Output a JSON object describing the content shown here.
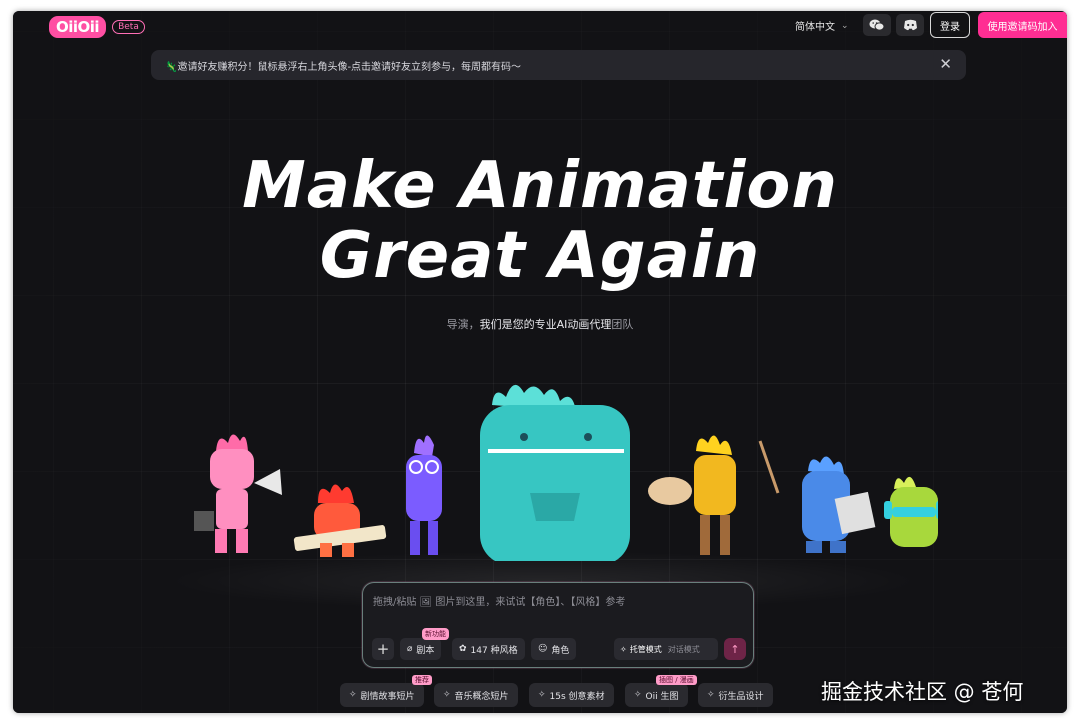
{
  "header": {
    "logo_text": "OiiOii",
    "beta_label": "Beta",
    "language": "简体中文",
    "login_label": "登录",
    "join_label": "使用邀请码加入"
  },
  "banner": {
    "text": "🦎邀请好友赚积分！鼠标悬浮右上角头像-点击邀请好友立刻参与，每周都有码～",
    "close_icon": "close-icon"
  },
  "hero": {
    "title_line1": "Make Animation",
    "title_line2": "Great Again",
    "subtitle_pre": "导演，",
    "subtitle_mid": "我们是您的专业AI动画代理",
    "subtitle_post": "团队"
  },
  "input": {
    "placeholder": "拖拽/粘贴 🖼 图片到这里，来试试【角色】、【风格】参考",
    "script_label": "剧本",
    "new_badge": "新功能",
    "style_label": "147 种风格",
    "character_label": "角色",
    "mode_active": "托管模式",
    "mode_idle": "对话模式"
  },
  "chips": [
    {
      "label": "剧情故事短片",
      "badge": "推荐"
    },
    {
      "label": "音乐概念短片",
      "badge": ""
    },
    {
      "label": "15s 创意素材",
      "badge": ""
    },
    {
      "label": "Oii 生图",
      "badge": "插图 / 漫画"
    },
    {
      "label": "衍生品设计",
      "badge": ""
    }
  ],
  "watermark": "掘金技术社区 @ 苍何",
  "colors": {
    "accent": "#ff2e93",
    "background": "#121215",
    "banner": "#26262c"
  }
}
